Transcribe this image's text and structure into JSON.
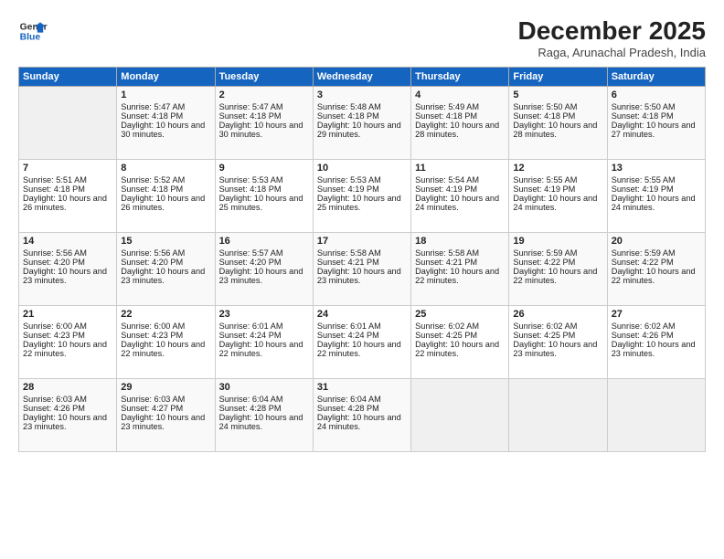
{
  "logo": {
    "line1": "General",
    "line2": "Blue"
  },
  "title": "December 2025",
  "subtitle": "Raga, Arunachal Pradesh, India",
  "days_header": [
    "Sunday",
    "Monday",
    "Tuesday",
    "Wednesday",
    "Thursday",
    "Friday",
    "Saturday"
  ],
  "weeks": [
    [
      {
        "day": "",
        "empty": true
      },
      {
        "day": "1",
        "sunrise": "5:47 AM",
        "sunset": "4:18 PM",
        "daylight": "10 hours and 30 minutes."
      },
      {
        "day": "2",
        "sunrise": "5:47 AM",
        "sunset": "4:18 PM",
        "daylight": "10 hours and 30 minutes."
      },
      {
        "day": "3",
        "sunrise": "5:48 AM",
        "sunset": "4:18 PM",
        "daylight": "10 hours and 29 minutes."
      },
      {
        "day": "4",
        "sunrise": "5:49 AM",
        "sunset": "4:18 PM",
        "daylight": "10 hours and 28 minutes."
      },
      {
        "day": "5",
        "sunrise": "5:50 AM",
        "sunset": "4:18 PM",
        "daylight": "10 hours and 28 minutes."
      },
      {
        "day": "6",
        "sunrise": "5:50 AM",
        "sunset": "4:18 PM",
        "daylight": "10 hours and 27 minutes."
      }
    ],
    [
      {
        "day": "7",
        "sunrise": "5:51 AM",
        "sunset": "4:18 PM",
        "daylight": "10 hours and 26 minutes."
      },
      {
        "day": "8",
        "sunrise": "5:52 AM",
        "sunset": "4:18 PM",
        "daylight": "10 hours and 26 minutes."
      },
      {
        "day": "9",
        "sunrise": "5:53 AM",
        "sunset": "4:18 PM",
        "daylight": "10 hours and 25 minutes."
      },
      {
        "day": "10",
        "sunrise": "5:53 AM",
        "sunset": "4:19 PM",
        "daylight": "10 hours and 25 minutes."
      },
      {
        "day": "11",
        "sunrise": "5:54 AM",
        "sunset": "4:19 PM",
        "daylight": "10 hours and 24 minutes."
      },
      {
        "day": "12",
        "sunrise": "5:55 AM",
        "sunset": "4:19 PM",
        "daylight": "10 hours and 24 minutes."
      },
      {
        "day": "13",
        "sunrise": "5:55 AM",
        "sunset": "4:19 PM",
        "daylight": "10 hours and 24 minutes."
      }
    ],
    [
      {
        "day": "14",
        "sunrise": "5:56 AM",
        "sunset": "4:20 PM",
        "daylight": "10 hours and 23 minutes."
      },
      {
        "day": "15",
        "sunrise": "5:56 AM",
        "sunset": "4:20 PM",
        "daylight": "10 hours and 23 minutes."
      },
      {
        "day": "16",
        "sunrise": "5:57 AM",
        "sunset": "4:20 PM",
        "daylight": "10 hours and 23 minutes."
      },
      {
        "day": "17",
        "sunrise": "5:58 AM",
        "sunset": "4:21 PM",
        "daylight": "10 hours and 23 minutes."
      },
      {
        "day": "18",
        "sunrise": "5:58 AM",
        "sunset": "4:21 PM",
        "daylight": "10 hours and 22 minutes."
      },
      {
        "day": "19",
        "sunrise": "5:59 AM",
        "sunset": "4:22 PM",
        "daylight": "10 hours and 22 minutes."
      },
      {
        "day": "20",
        "sunrise": "5:59 AM",
        "sunset": "4:22 PM",
        "daylight": "10 hours and 22 minutes."
      }
    ],
    [
      {
        "day": "21",
        "sunrise": "6:00 AM",
        "sunset": "4:23 PM",
        "daylight": "10 hours and 22 minutes."
      },
      {
        "day": "22",
        "sunrise": "6:00 AM",
        "sunset": "4:23 PM",
        "daylight": "10 hours and 22 minutes."
      },
      {
        "day": "23",
        "sunrise": "6:01 AM",
        "sunset": "4:24 PM",
        "daylight": "10 hours and 22 minutes."
      },
      {
        "day": "24",
        "sunrise": "6:01 AM",
        "sunset": "4:24 PM",
        "daylight": "10 hours and 22 minutes."
      },
      {
        "day": "25",
        "sunrise": "6:02 AM",
        "sunset": "4:25 PM",
        "daylight": "10 hours and 22 minutes."
      },
      {
        "day": "26",
        "sunrise": "6:02 AM",
        "sunset": "4:25 PM",
        "daylight": "10 hours and 23 minutes."
      },
      {
        "day": "27",
        "sunrise": "6:02 AM",
        "sunset": "4:26 PM",
        "daylight": "10 hours and 23 minutes."
      }
    ],
    [
      {
        "day": "28",
        "sunrise": "6:03 AM",
        "sunset": "4:26 PM",
        "daylight": "10 hours and 23 minutes."
      },
      {
        "day": "29",
        "sunrise": "6:03 AM",
        "sunset": "4:27 PM",
        "daylight": "10 hours and 23 minutes."
      },
      {
        "day": "30",
        "sunrise": "6:04 AM",
        "sunset": "4:28 PM",
        "daylight": "10 hours and 24 minutes."
      },
      {
        "day": "31",
        "sunrise": "6:04 AM",
        "sunset": "4:28 PM",
        "daylight": "10 hours and 24 minutes."
      },
      {
        "day": "",
        "empty": true
      },
      {
        "day": "",
        "empty": true
      },
      {
        "day": "",
        "empty": true
      }
    ]
  ],
  "labels": {
    "sunrise_prefix": "Sunrise: ",
    "sunset_prefix": "Sunset: ",
    "daylight_prefix": "Daylight: "
  }
}
